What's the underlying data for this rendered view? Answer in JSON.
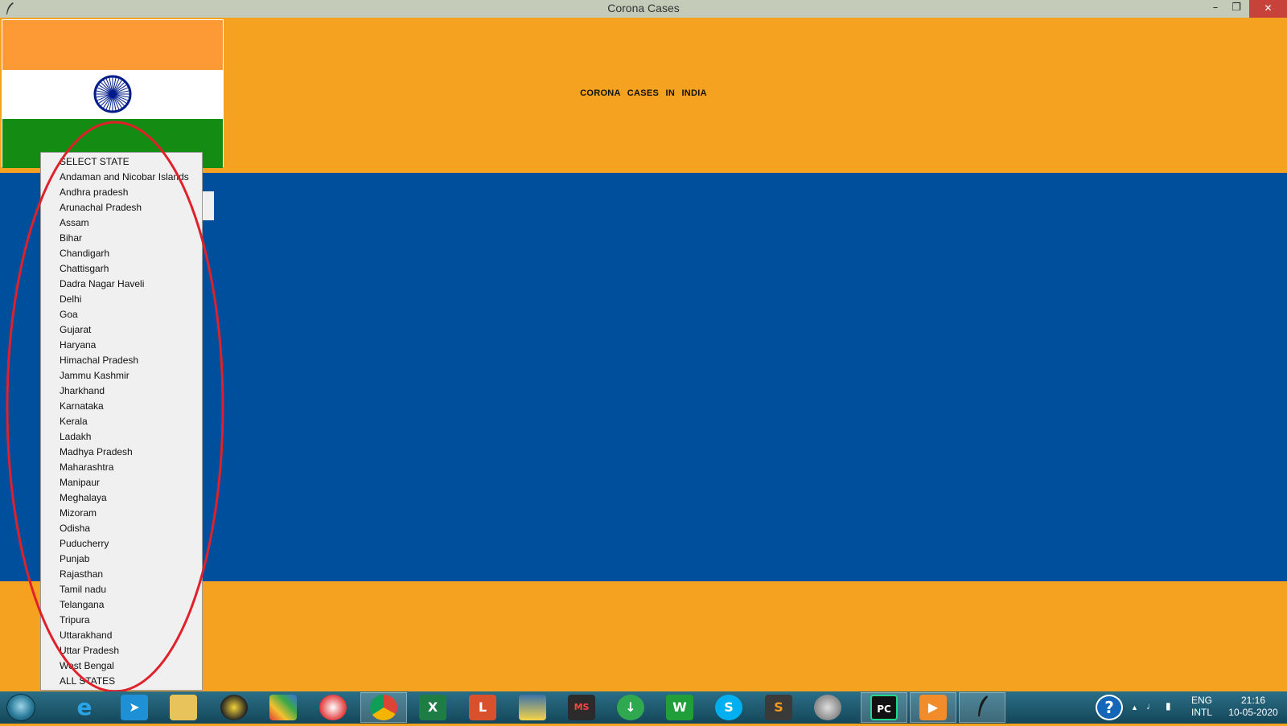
{
  "window": {
    "title": "Corona Cases",
    "minimize": "–",
    "maximize": "❐",
    "close": "✕"
  },
  "header": {
    "heading": "CORONA  CASES  IN  INDIA"
  },
  "dropdown": {
    "items": [
      "SELECT STATE",
      "Andaman and Nicobar Islands",
      "Andhra pradesh",
      "Arunachal Pradesh",
      "Assam",
      "Bihar",
      "Chandigarh",
      "Chattisgarh",
      "Dadra Nagar Haveli",
      "Delhi",
      "Goa",
      "Gujarat",
      "Haryana",
      "Himachal Pradesh",
      "Jammu Kashmir",
      "Jharkhand",
      "Karnataka",
      "Kerala",
      "Ladakh",
      "Madhya Pradesh",
      "Maharashtra",
      "Manipaur",
      "Meghalaya",
      "Mizoram",
      "Odisha",
      "Puducherry",
      "Punjab",
      "Rajasthan",
      "Tamil nadu",
      "Telangana",
      "Tripura",
      "Uttarakhand",
      "Uttar Pradesh",
      "West Bengal",
      "ALL STATES"
    ]
  },
  "taskbar": {
    "icons": [
      "ie-icon",
      "rocket-icon",
      "file-explorer-icon",
      "media-disc-icon",
      "puzzle-icon",
      "transfer-icon",
      "chrome-icon",
      "excel-icon",
      "word-icon",
      "python-icon",
      "ms-icon",
      "download-icon",
      "store-icon",
      "skype-icon",
      "sublime-icon",
      "tool-icon",
      "pycharm-icon",
      "player-icon",
      "feather-icon"
    ],
    "labels": {
      "excel": "X",
      "word": "L",
      "ms": "MS",
      "store": "W",
      "skype": "S",
      "sublime": "S",
      "pycharm": "PC"
    },
    "help": "?",
    "language": "ENG",
    "keyboard": "INTL",
    "time": "21:16",
    "date": "10-05-2020",
    "tray_arrow": "▲",
    "volume": "🔈"
  },
  "colors": {
    "orange": "#f4a21f",
    "blue": "#004f9d",
    "saffron": "#fe9a35",
    "green": "#148b13",
    "chakra": "#001c8a",
    "annotation": "#e0202a"
  }
}
